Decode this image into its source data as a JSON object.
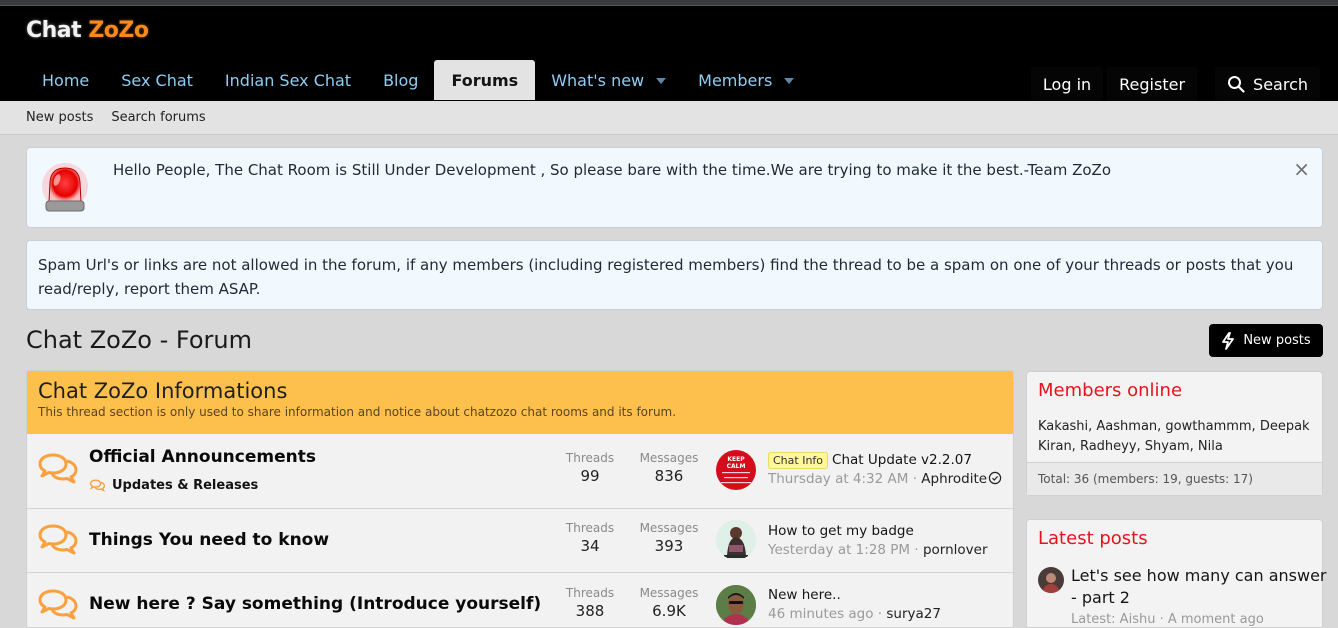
{
  "site": {
    "logo_part1": "Chat",
    "logo_part2": "ZoZo"
  },
  "nav": {
    "items": [
      {
        "label": "Home"
      },
      {
        "label": "Sex Chat"
      },
      {
        "label": "Indian Sex Chat"
      },
      {
        "label": "Blog"
      },
      {
        "label": "Forums",
        "active": true
      },
      {
        "label": "What's new",
        "dropdown": true
      },
      {
        "label": "Members",
        "dropdown": true
      }
    ],
    "login": "Log in",
    "register": "Register",
    "search": "Search"
  },
  "subnav": {
    "items": [
      "New posts",
      "Search forums"
    ]
  },
  "notices": {
    "notice1": "Hello People, The Chat Room is Still Under Development , So please bare with the time.We are trying to make it the best.-Team ZoZo",
    "close_icon": "×",
    "notice2": "Spam Url's or links are not allowed in the forum, if any members (including registered members) find the thread to be a spam on one of your threads or posts that you read/reply, report them ASAP."
  },
  "page": {
    "title": "Chat ZoZo - Forum",
    "new_posts_button": "New posts"
  },
  "category": {
    "title": "Chat ZoZo Informations",
    "description": "This thread section is only used to share information and notice about chatzozo chat rooms and its forum.",
    "nodes": [
      {
        "title": "Official Announcements",
        "subforum": "Updates & Releases",
        "threads_label": "Threads",
        "threads": "99",
        "messages_label": "Messages",
        "messages": "836",
        "last_prefix": "Chat Info",
        "last_title": "Chat Update v2.2.07",
        "last_time": "Thursday at 4:32 AM",
        "last_user": "Aphrodite"
      },
      {
        "title": "Things You need to know",
        "threads_label": "Threads",
        "threads": "34",
        "messages_label": "Messages",
        "messages": "393",
        "last_title": "How to get my badge",
        "last_time": "Yesterday at 1:28 PM",
        "last_user": "pornlover"
      },
      {
        "title": "New here ? Say something (Introduce yourself)",
        "threads_label": "Threads",
        "threads": "388",
        "messages_label": "Messages",
        "messages": "6.9K",
        "last_title": "New here..",
        "last_time": "46 minutes ago",
        "last_user": "surya27"
      }
    ]
  },
  "sidebar": {
    "members_online": {
      "title": "Members online",
      "list": "Kakashi, Aashman, gowthammm, Deepak Kiran, Radheyy, Shyam, Nila",
      "total": "Total: 36 (members: 19, guests: 17)"
    },
    "latest_posts": {
      "title": "Latest posts",
      "items": [
        {
          "title": "Let's see how many can answer - part 2",
          "meta": "Latest: Aishu · A moment ago"
        }
      ]
    }
  },
  "colors": {
    "accent_orange": "#fec04c",
    "nav_link": "#8fcdf2",
    "widget_title": "#e8121d",
    "logo_orange": "#f58b1e"
  }
}
